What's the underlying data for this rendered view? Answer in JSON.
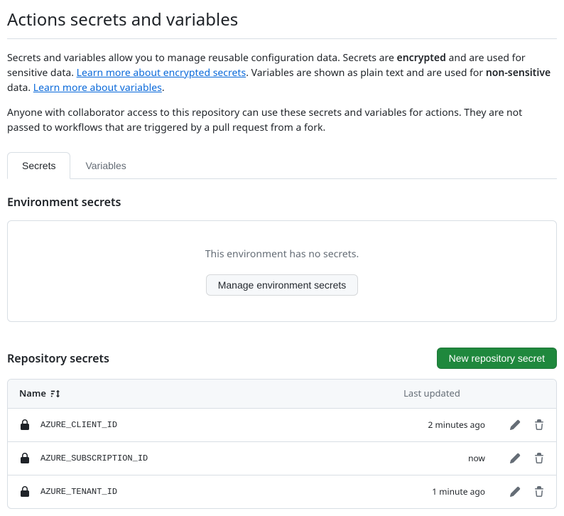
{
  "title": "Actions secrets and variables",
  "intro": {
    "p1_pre": "Secrets and variables allow you to manage reusable configuration data. Secrets are ",
    "p1_bold1": "encrypted",
    "p1_mid": " and are used for sensitive data. ",
    "p1_link1": "Learn more about encrypted secrets",
    "p1_mid2": ". Variables are shown as plain text and are used for ",
    "p1_bold2": "non-sensitive",
    "p1_mid3": " data. ",
    "p1_link2": "Learn more about variables",
    "p1_end": ".",
    "p2": "Anyone with collaborator access to this repository can use these secrets and variables for actions. They are not passed to workflows that are triggered by a pull request from a fork."
  },
  "tabs": {
    "secrets": "Secrets",
    "variables": "Variables"
  },
  "env": {
    "heading": "Environment secrets",
    "empty_text": "This environment has no secrets.",
    "manage_button": "Manage environment secrets"
  },
  "repo": {
    "heading": "Repository secrets",
    "new_button": "New repository secret",
    "columns": {
      "name": "Name",
      "updated": "Last updated"
    },
    "rows": [
      {
        "name": "AZURE_CLIENT_ID",
        "updated": "2 minutes ago"
      },
      {
        "name": "AZURE_SUBSCRIPTION_ID",
        "updated": "now"
      },
      {
        "name": "AZURE_TENANT_ID",
        "updated": "1 minute ago"
      }
    ]
  }
}
